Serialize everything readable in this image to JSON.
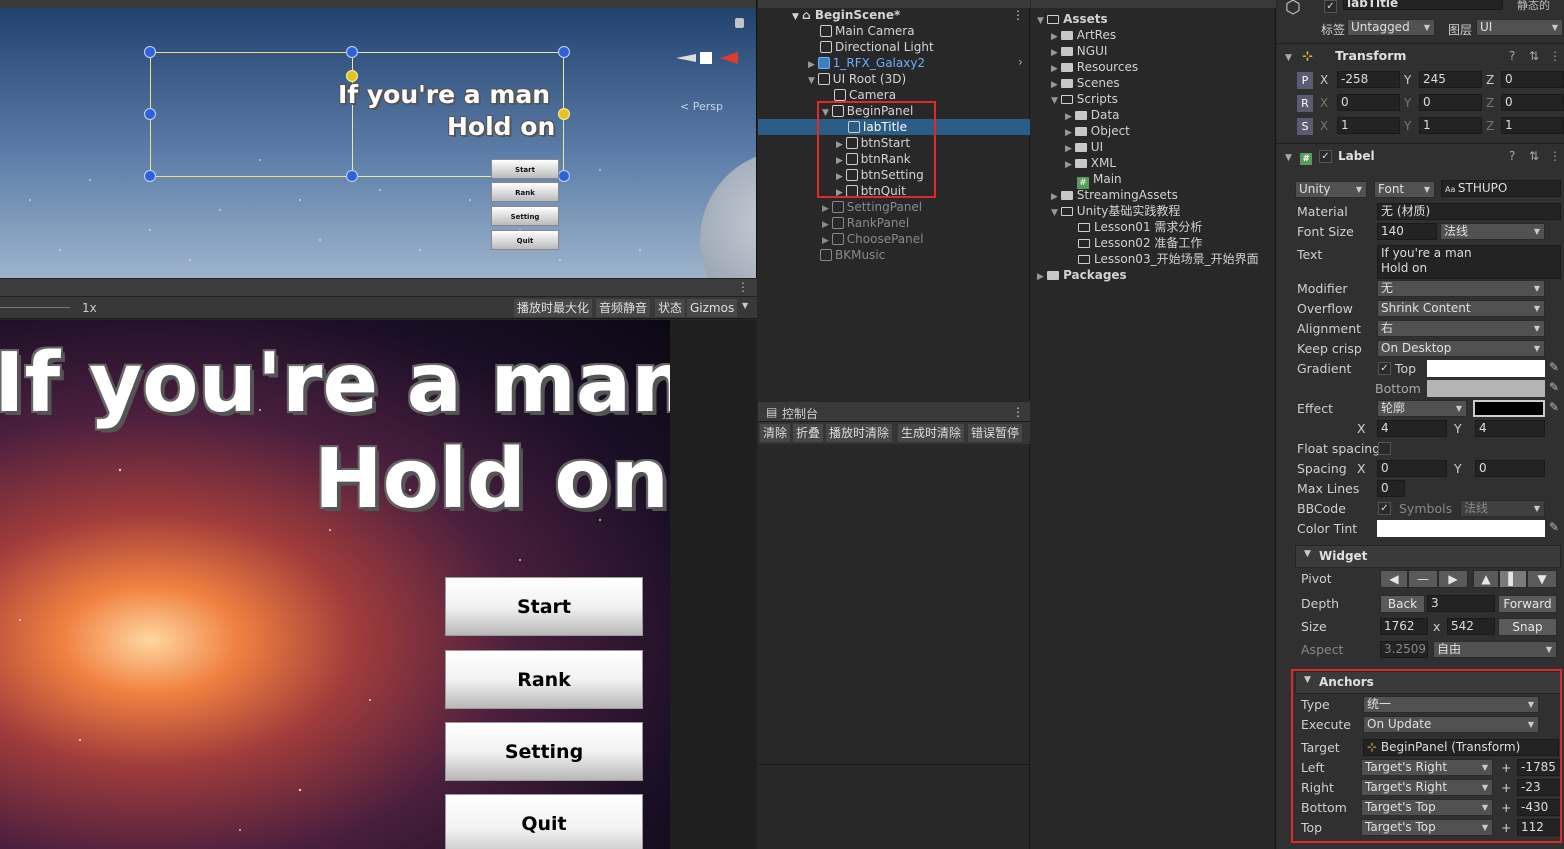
{
  "scene": {
    "title_line1": "If you're a man",
    "title_line2": "Hold on",
    "mini_buttons": [
      "Start",
      "Rank",
      "Setting",
      "Quit"
    ],
    "persp_label": "< Persp"
  },
  "game_toolbar": {
    "scale": "1x",
    "buttons": [
      "播放时最大化",
      "音频静音",
      "状态",
      "Gizmos"
    ]
  },
  "game": {
    "title_line1": "If you're a man",
    "title_line2": "Hold on",
    "buttons": [
      "Start",
      "Rank",
      "Setting",
      "Quit"
    ]
  },
  "hierarchy": {
    "items": [
      {
        "label": "BeginScene*",
        "indent": 0,
        "bold": true,
        "dim": false
      },
      {
        "label": "Main Camera",
        "indent": 1,
        "dim": false
      },
      {
        "label": "Directional Light",
        "indent": 1,
        "dim": false
      },
      {
        "label": "1_RFX_Galaxy2",
        "indent": 1,
        "dim": false,
        "prefab": true
      },
      {
        "label": "UI Root (3D)",
        "indent": 1,
        "dim": false
      },
      {
        "label": "Camera",
        "indent": 2,
        "dim": false
      },
      {
        "label": "BeginPanel",
        "indent": 2,
        "dim": false
      },
      {
        "label": "labTitle",
        "indent": 3,
        "dim": false,
        "selected": true
      },
      {
        "label": "btnStart",
        "indent": 3,
        "dim": false
      },
      {
        "label": "btnRank",
        "indent": 3,
        "dim": false
      },
      {
        "label": "btnSetting",
        "indent": 3,
        "dim": false
      },
      {
        "label": "btnQuit",
        "indent": 3,
        "dim": false
      },
      {
        "label": "SettingPanel",
        "indent": 2,
        "dim": true
      },
      {
        "label": "RankPanel",
        "indent": 2,
        "dim": true
      },
      {
        "label": "ChoosePanel",
        "indent": 2,
        "dim": true
      },
      {
        "label": "BKMusic",
        "indent": 1,
        "dim": true
      }
    ]
  },
  "console": {
    "tab": "控制台",
    "buttons": [
      "清除",
      "折叠",
      "播放时清除",
      "生成时清除",
      "错误暂停"
    ]
  },
  "project": {
    "items": [
      {
        "label": "Assets",
        "indent": 0,
        "bold": true
      },
      {
        "label": "ArtRes",
        "indent": 1
      },
      {
        "label": "NGUI",
        "indent": 1
      },
      {
        "label": "Resources",
        "indent": 1
      },
      {
        "label": "Scenes",
        "indent": 1
      },
      {
        "label": "Scripts",
        "indent": 1
      },
      {
        "label": "Data",
        "indent": 2
      },
      {
        "label": "Object",
        "indent": 2
      },
      {
        "label": "UI",
        "indent": 2
      },
      {
        "label": "XML",
        "indent": 2
      },
      {
        "label": "Main",
        "indent": 2,
        "script": true
      },
      {
        "label": "StreamingAssets",
        "indent": 1
      },
      {
        "label": "Unity基础实践教程",
        "indent": 1
      },
      {
        "label": "Lesson01 需求分析",
        "indent": 2,
        "empty": true
      },
      {
        "label": "Lesson02 准备工作",
        "indent": 2,
        "empty": true
      },
      {
        "label": "Lesson03_开始场景_开始界面",
        "indent": 2,
        "empty": true
      },
      {
        "label": "Packages",
        "indent": 0,
        "bold": true
      }
    ]
  },
  "inspector": {
    "object_name": "labTitle",
    "static_label": "静态的",
    "tag_label": "标签",
    "tag_value": "Untagged",
    "layer_label": "图层",
    "layer_value": "UI",
    "transform": {
      "title": "Transform",
      "p": [
        "-258",
        "245",
        "0"
      ],
      "r": [
        "0",
        "0",
        "0"
      ],
      "s": [
        "1",
        "1",
        "1"
      ]
    },
    "label": {
      "title": "Label",
      "font_type": "Unity",
      "font_kind": "Font",
      "font_name": "STHUPO",
      "material_label": "Material",
      "material": "无 (材质)",
      "font_size_label": "Font Size",
      "font_size": "140",
      "font_style": "法线",
      "text_label": "Text",
      "text1": "If you're a man",
      "text2": "Hold on",
      "modifier_label": "Modifier",
      "modifier": "无",
      "overflow_label": "Overflow",
      "overflow": "Shrink Content",
      "alignment_label": "Alignment",
      "alignment": "右",
      "keep_crisp_label": "Keep crisp",
      "keep_crisp": "On Desktop",
      "gradient_label": "Gradient",
      "gradient_top": "Top",
      "gradient_bottom": "Bottom",
      "effect_label": "Effect",
      "effect": "轮廓",
      "effect_x": "4",
      "effect_y": "4",
      "float_spacing_label": "Float spacing",
      "spacing_label": "Spacing",
      "spacing_x": "0",
      "spacing_y": "0",
      "max_lines_label": "Max Lines",
      "max_lines": "0",
      "bbcode_label": "BBCode",
      "symbols_label": "Symbols",
      "symbols_value": "法线",
      "color_tint_label": "Color Tint"
    },
    "widget": {
      "title": "Widget",
      "pivot_label": "Pivot",
      "depth_label": "Depth",
      "depth_back": "Back",
      "depth": "3",
      "depth_forward": "Forward",
      "size_label": "Size",
      "width": "1762",
      "height": "542",
      "snap": "Snap",
      "aspect_label": "Aspect",
      "aspect": "3.25092",
      "aspect_mode": "自由"
    },
    "anchors": {
      "title": "Anchors",
      "type_label": "Type",
      "type": "统一",
      "execute_label": "Execute",
      "execute": "On Update",
      "target_label": "Target",
      "target": "BeginPanel (Transform)",
      "rows": [
        {
          "label": "Left",
          "ref": "Target's Right",
          "value": "-1785"
        },
        {
          "label": "Right",
          "ref": "Target's Right",
          "value": "-23"
        },
        {
          "label": "Bottom",
          "ref": "Target's Top",
          "value": "-430"
        },
        {
          "label": "Top",
          "ref": "Target's Top",
          "value": "112"
        }
      ]
    }
  }
}
